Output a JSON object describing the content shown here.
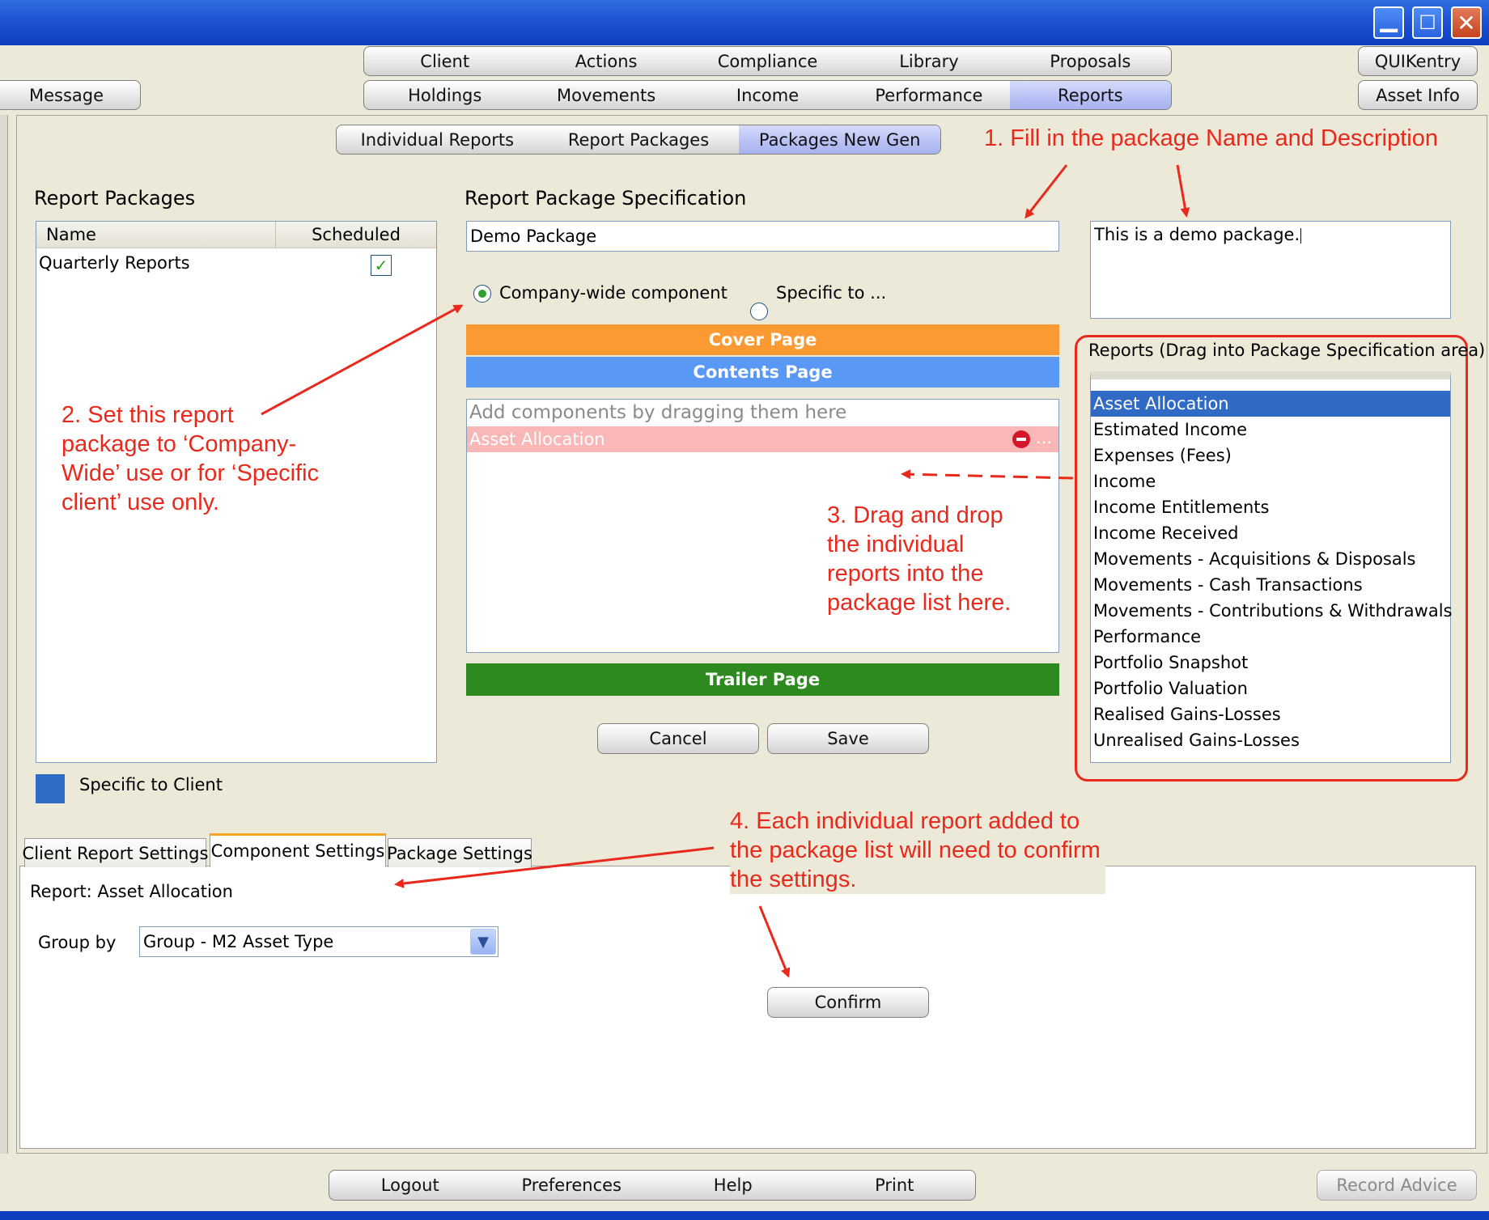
{
  "nav": {
    "row1": [
      "Client",
      "Actions",
      "Compliance",
      "Library",
      "Proposals"
    ],
    "row2": [
      "Holdings",
      "Movements",
      "Income",
      "Performance",
      "Reports"
    ],
    "message_label": "Message",
    "quikentry_label": "QUIKentry",
    "asset_info_label": "Asset Info"
  },
  "report_tabs": [
    "Individual Reports",
    "Report Packages",
    "Packages New Gen"
  ],
  "packages": {
    "heading": "Report Packages",
    "col_name": "Name",
    "col_scheduled": "Scheduled",
    "rows": [
      {
        "name": "Quarterly Reports",
        "scheduled": true
      }
    ],
    "legend_label": "Specific to Client"
  },
  "spec": {
    "heading": "Report Package Specification",
    "name_value": "Demo Package",
    "description_value": "This is a demo package.",
    "radio_company": "Company-wide component",
    "radio_specific": "Specific to ...",
    "cover_page": "Cover Page",
    "contents_page": "Contents Page",
    "drop_placeholder": "Add components by dragging them here",
    "added_component": "Asset Allocation",
    "added_more": "...",
    "trailer_page": "Trailer Page",
    "cancel_label": "Cancel",
    "save_label": "Save"
  },
  "reports_list": {
    "heading": "Reports (Drag into Package Specification area)",
    "items": [
      "Asset Allocation",
      "Estimated Income",
      "Expenses (Fees)",
      "Income",
      "Income Entitlements",
      "Income Received",
      "Movements - Acquisitions & Disposals",
      "Movements - Cash Transactions",
      "Movements - Contributions & Withdrawals",
      "Performance",
      "Portfolio Snapshot",
      "Portfolio Valuation",
      "Realised Gains-Losses",
      "Unrealised Gains-Losses"
    ]
  },
  "settings": {
    "tabs": [
      "Client Report Settings",
      "Component Settings",
      "Package Settings"
    ],
    "report_label": "Report: Asset Allocation",
    "group_by_label": "Group by",
    "group_by_value": "Group - M2 Asset Type",
    "confirm_label": "Confirm"
  },
  "annotations": {
    "a1": "1. Fill in the package Name and Description",
    "a2_lines": [
      "2. Set this report",
      "package to ‘Company-",
      "Wide’ use or for ‘Specific",
      "client’ use only."
    ],
    "a3_lines": [
      "3. Drag and drop",
      "the individual",
      "reports into the",
      "package list here."
    ],
    "a4_lines": [
      "4. Each individual report added to",
      "the package list will need to confirm",
      "the settings."
    ]
  },
  "footer": {
    "buttons": [
      "Logout",
      "Preferences",
      "Help",
      "Print"
    ],
    "record_advice_label": "Record Advice"
  },
  "colors": {
    "cover": "#fb9a32",
    "contents": "#5a98f6",
    "trailer": "#2c8a1e",
    "annotation": "#e8291c",
    "selection": "#316ac5"
  }
}
